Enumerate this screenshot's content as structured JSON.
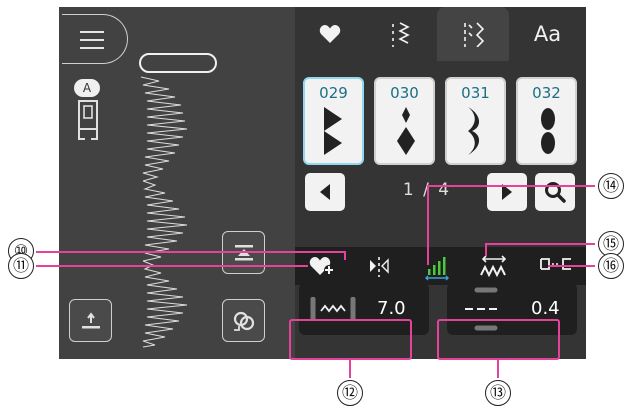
{
  "tabs": [
    {
      "label": "",
      "icon": "heart-icon"
    },
    {
      "label": "",
      "icon": "decorative-stitch-icon"
    },
    {
      "label": "",
      "icon": "utility-stitch-icon"
    },
    {
      "label": "Aa",
      "icon": "character-icon"
    }
  ],
  "left_panel": {
    "presser_foot_letter": "A"
  },
  "stitches": [
    {
      "number": "029"
    },
    {
      "number": "030"
    },
    {
      "number": "031"
    },
    {
      "number": "032"
    }
  ],
  "pagination": {
    "current": "1",
    "separator": "/",
    "total": "4"
  },
  "params": {
    "width_value": "7.0",
    "length_value": "0.4"
  },
  "callouts": {
    "c10": "⑩",
    "c11": "⑪",
    "c12": "⑫",
    "c13": "⑬",
    "c14": "⑭",
    "c15": "⑮",
    "c16": "⑯"
  },
  "colors": {
    "highlight": "#e4429b",
    "accent_green": "#4bc93f",
    "accent_blue": "#3aa0d8",
    "card_text": "#1a6f86"
  }
}
